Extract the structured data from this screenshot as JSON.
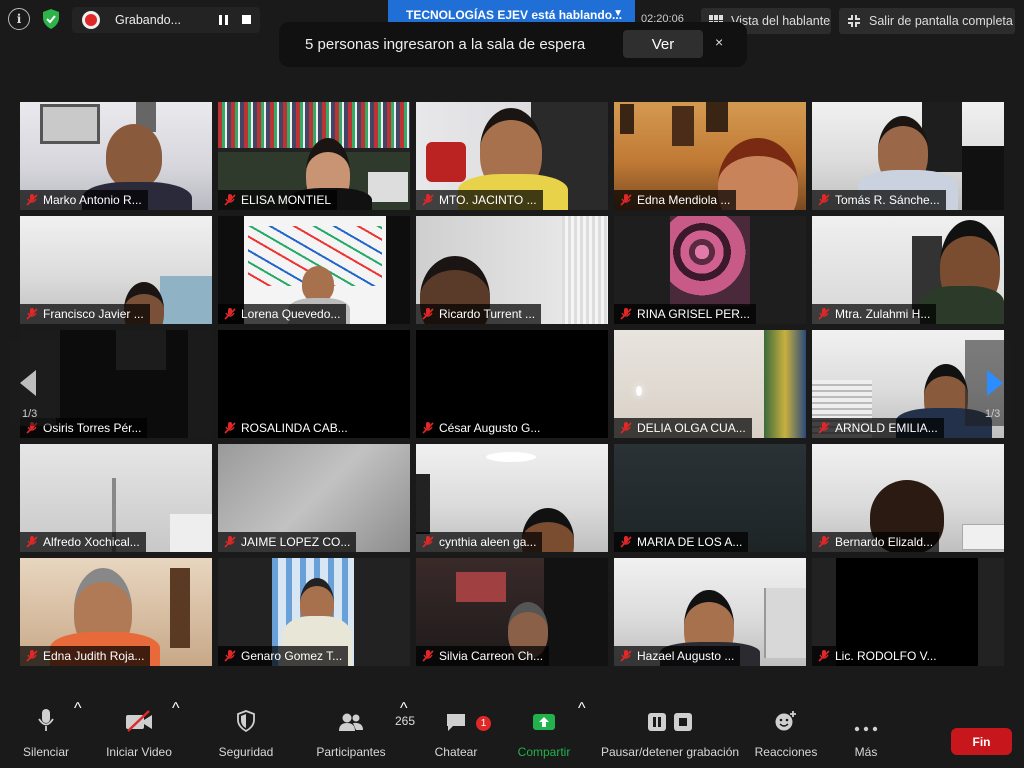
{
  "topbar": {
    "info_icon": "info-icon",
    "shield_color": "#2db34a",
    "recording": {
      "label": "Grabando..."
    },
    "speaking_banner": "TECNOLOGÍAS EJEV está hablando...",
    "timer": "02:20:06",
    "speaker_view": "Vista del hablante",
    "exit_fullscreen": "Salir de pantalla completa"
  },
  "notification": {
    "message": "5 personas ingresaron a la sala de espera",
    "view_button": "Ver",
    "close": "×"
  },
  "pager": {
    "left": "1/3",
    "right": "1/3"
  },
  "participants": [
    {
      "name": "Marko Antonio R..."
    },
    {
      "name": "ELISA MONTIEL"
    },
    {
      "name": "MTO. JACINTO ..."
    },
    {
      "name": "Edna Mendiola ..."
    },
    {
      "name": "Tomás R. Sánche..."
    },
    {
      "name": "Francisco Javier ..."
    },
    {
      "name": "Lorena Quevedo..."
    },
    {
      "name": "Ricardo Turrent ..."
    },
    {
      "name": "RINA GRISEL PER..."
    },
    {
      "name": "Mtra. Zulahmi H..."
    },
    {
      "name": "Osiris Torres Pér..."
    },
    {
      "name": "ROSALINDA CAB..."
    },
    {
      "name": "César Augusto G..."
    },
    {
      "name": "DELIA OLGA CUA..."
    },
    {
      "name": "ARNOLD EMILIA..."
    },
    {
      "name": "Alfredo Xochical..."
    },
    {
      "name": "JAIME LOPEZ CO..."
    },
    {
      "name": "cynthia aleen ga..."
    },
    {
      "name": "MARIA DE LOS A..."
    },
    {
      "name": "Bernardo Elizald..."
    },
    {
      "name": "Edna Judith Roja..."
    },
    {
      "name": "Genaro Gomez T..."
    },
    {
      "name": "Silvia Carreon Ch..."
    },
    {
      "name": "Hazael Augusto ..."
    },
    {
      "name": "Lic. RODOLFO V..."
    }
  ],
  "toolbar": {
    "mute": "Silenciar",
    "start_video": "Iniciar Video",
    "security": "Seguridad",
    "participants": "Participantes",
    "participants_count": "265",
    "chat": "Chatear",
    "chat_badge": "1",
    "share": "Compartir",
    "recording_controls": "Pausar/detener grabación",
    "reactions": "Reacciones",
    "more": "Más",
    "end": "Fin"
  },
  "colors": {
    "accent_blue": "#2d8cff",
    "share_green": "#23b14d",
    "end_red": "#c8161d",
    "muted_red": "#e02828"
  }
}
